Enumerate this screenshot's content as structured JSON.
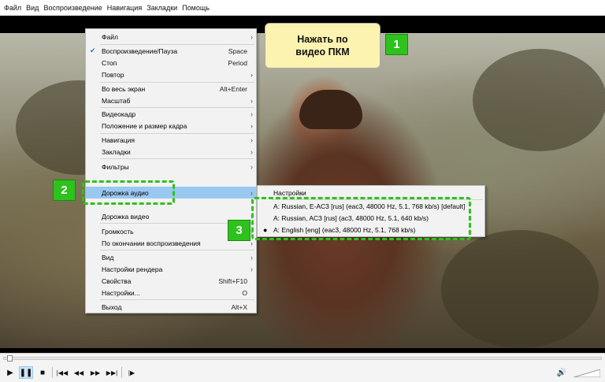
{
  "menubar": [
    "Файл",
    "Вид",
    "Воспроизведение",
    "Навигация",
    "Закладки",
    "Помощь"
  ],
  "context_menu": [
    {
      "label": "Файл",
      "submenu": true
    },
    {
      "label": "Воспроизведение/Пауза",
      "key": "Space",
      "checked": true
    },
    {
      "label": "Стоп",
      "key": "Period"
    },
    {
      "label": "Повтор",
      "submenu": true
    },
    {
      "label": "Во весь экран",
      "key": "Alt+Enter"
    },
    {
      "label": "Масштаб",
      "submenu": true
    },
    {
      "label": "Видеокадр",
      "submenu": true
    },
    {
      "label": "Положение и размер кадра",
      "submenu": true
    },
    {
      "label": "Навигация",
      "submenu": true
    },
    {
      "label": "Закладки",
      "submenu": true
    },
    {
      "label": "Фильтры",
      "submenu": true
    },
    {
      "label": "Дорожка аудио",
      "submenu": true,
      "highlighted": true
    },
    {
      "label": "Дорожка видео",
      "submenu": true
    },
    {
      "label": "Громкость",
      "submenu": true
    },
    {
      "label": "По окончании воспроизведения",
      "submenu": true
    },
    {
      "label": "Вид",
      "submenu": true
    },
    {
      "label": "Настройки рендера",
      "submenu": true
    },
    {
      "label": "Свойства",
      "key": "Shift+F10"
    },
    {
      "label": "Настройки...",
      "key": "O"
    },
    {
      "label": "Выход",
      "key": "Alt+X"
    }
  ],
  "audio_submenu": [
    {
      "label": "Настройки"
    },
    {
      "label": "A: Russian, E-AC3 [rus] (eac3, 48000 Hz, 5.1, 768 kb/s) [default]"
    },
    {
      "label": "A: Russian, AC3 [rus] (ac3, 48000 Hz, 5.1, 640 kb/s)"
    },
    {
      "label": "A: English [eng] (eac3, 48000 Hz, 5.1, 768 kb/s)",
      "selected": true
    }
  ],
  "callout": {
    "line1": "Нажать по",
    "line2": "видео ПКМ"
  },
  "badges": [
    "1",
    "2",
    "3"
  ],
  "controls": {
    "play": "▶",
    "pause": "❚❚",
    "stop": "■",
    "prev": "|◀◀",
    "rewind": "◀◀",
    "forward": "▶▶",
    "next": "▶▶|",
    "frame_step": "|▶",
    "volume_icon": "🔊",
    "seek_position": 0.01
  },
  "colors": {
    "highlight": "#99c8f0",
    "annotation_green": "#2ec21c",
    "callout_bg": "#fdf3b0"
  }
}
